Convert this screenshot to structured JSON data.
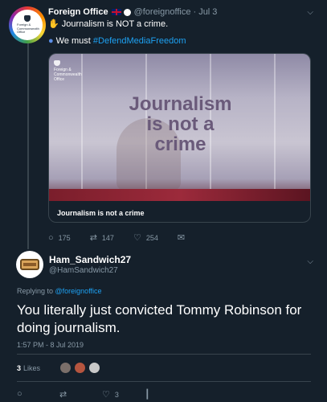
{
  "parent_tweet": {
    "name": "Foreign Office",
    "handle": "@foreignoffice",
    "date": "· Jul 3",
    "avatar_text": "Foreign & Commonwealth Office",
    "text": "Journalism is NOT a crime.",
    "line2_prefix": "We must ",
    "hashtag": "#DefendMediaFreedom",
    "card": {
      "logo_text": "Foreign & Commonwealth Office",
      "headline_lines": [
        "Journalism",
        "is not a",
        "crime"
      ],
      "caption": "Journalism is not a crime"
    },
    "actions": {
      "replies": "175",
      "retweets": "147",
      "likes": "254"
    }
  },
  "reply_tweet": {
    "name": "Ham_Sandwich27",
    "handle": "@HamSandwich27",
    "replying_prefix": "Replying to ",
    "replying_mention": "@foreignoffice",
    "text": "You literally just convicted Tommy Robinson for doing journalism.",
    "timestamp": "1:57 PM - 8 Jul 2019",
    "likes_count": "3",
    "likes_label": "Likes",
    "action_like_count": "3"
  },
  "colors": {
    "background": "#15202b",
    "accent": "#1da1f2",
    "muted": "#8899a6",
    "border": "#38444d"
  }
}
